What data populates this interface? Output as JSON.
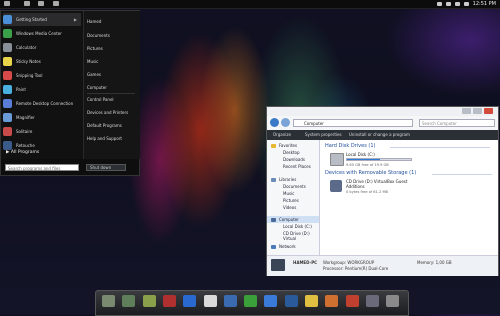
{
  "start_menu": {
    "programs": [
      {
        "label": "Getting Started",
        "color": "#4a8fd8"
      },
      {
        "label": "Windows Media Center",
        "color": "#3aa04a"
      },
      {
        "label": "Calculator",
        "color": "#8a9099"
      },
      {
        "label": "Sticky Notes",
        "color": "#e8d54a"
      },
      {
        "label": "Snipping Tool",
        "color": "#d84a4a"
      },
      {
        "label": "Paint",
        "color": "#4ab0e0"
      },
      {
        "label": "Remote Desktop Connection",
        "color": "#5a7ed8"
      },
      {
        "label": "Magnifier",
        "color": "#6a9ad8"
      },
      {
        "label": "Solitaire",
        "color": "#c84a4a"
      },
      {
        "label": "Retouche",
        "color": "#3a5a8a"
      }
    ],
    "all_programs": "All Programs",
    "search_placeholder": "Search programs and files",
    "places": [
      "Hamed",
      "Documents",
      "Pictures",
      "Music",
      "Games",
      "Computer",
      "Control Panel",
      "Devices and Printers",
      "Default Programs",
      "Help and Support"
    ],
    "shutdown_label": "Shut down"
  },
  "explorer": {
    "address": "Computer",
    "search_placeholder": "Search Computer",
    "toolbar": [
      "Organize",
      "System properties",
      "Uninstall or change a program"
    ],
    "nav": {
      "favorites": "Favorites",
      "favorites_items": [
        "Desktop",
        "Downloads",
        "Recent Places"
      ],
      "libraries": "Libraries",
      "libraries_items": [
        "Documents",
        "Music",
        "Pictures",
        "Videos"
      ],
      "computer": "Computer",
      "computer_items": [
        "Local Disk (C:)",
        "CD Drive (D:) Virtual"
      ],
      "network": "Network"
    },
    "hdd_group": "Hard Disk Drives (1)",
    "local_disk": {
      "name": "Local Disk (C:)",
      "free": "9.65 GB free of 19.9 GB",
      "used_fraction": 0.52
    },
    "removable_group": "Devices with Removable Storage (1)",
    "cd_drive": {
      "name_line1": "CD Drive (D:) VirtualBox Guest",
      "name_line2": "Additions",
      "free": "0 bytes free of 61.2 MB"
    },
    "status": {
      "pc_name": "HAMED-PC",
      "workgroup": "Workgroup: WORKGROUP",
      "processor": "Processor: Pentium(R) Dual-Core",
      "memory": "Memory: 1,00 GB"
    }
  },
  "dock": {
    "items": [
      {
        "label": "",
        "icon": "folder-icon",
        "color": "#7a8a70"
      },
      {
        "label": "",
        "icon": "pictures-icon",
        "color": "#5f7f5a"
      },
      {
        "label": "",
        "icon": "music-icon",
        "color": "#8aa04a"
      },
      {
        "label": "",
        "icon": "game-icon",
        "color": "#b03030"
      },
      {
        "label": "",
        "icon": "globe-icon",
        "color": "#2a6ad0"
      },
      {
        "label": "",
        "icon": "camera-icon",
        "color": "#dadada"
      },
      {
        "label": "",
        "icon": "network-icon",
        "color": "#3a6ab0"
      },
      {
        "label": "",
        "icon": "media-player-icon",
        "color": "#3aa03a"
      },
      {
        "label": "",
        "icon": "chrome-icon",
        "color": "#3a7ad8"
      },
      {
        "label": "",
        "icon": "globe2-icon",
        "color": "#2a5a9a"
      },
      {
        "label": "",
        "icon": "notes-icon",
        "color": "#e0c040"
      },
      {
        "label": "",
        "icon": "pencil-icon",
        "color": "#d07030"
      },
      {
        "label": "",
        "icon": "gift-icon",
        "color": "#c04030"
      },
      {
        "label": "",
        "icon": "monitor-icon",
        "color": "#6a6a7a"
      },
      {
        "label": "",
        "icon": "trash-icon",
        "color": "#8a8a8a"
      }
    ]
  },
  "clock": "12:51 PM"
}
